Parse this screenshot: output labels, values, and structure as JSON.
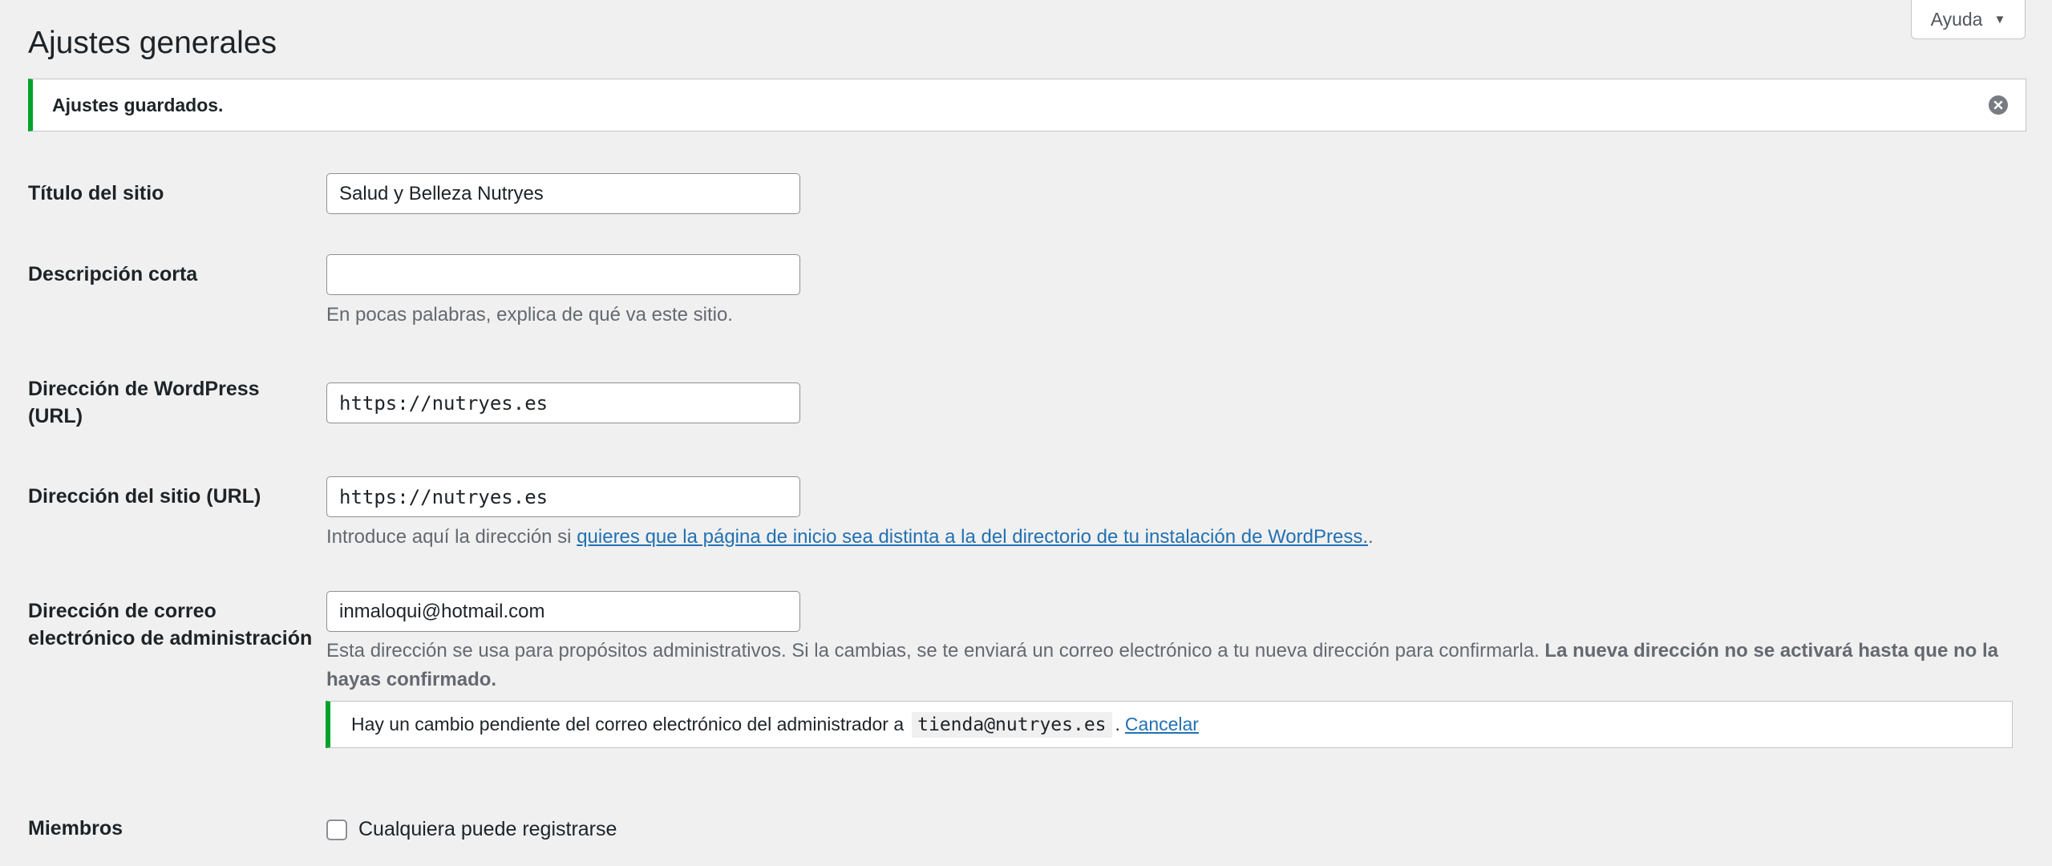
{
  "help_tab": {
    "label": "Ayuda"
  },
  "page": {
    "title": "Ajustes generales"
  },
  "notice": {
    "text": "Ajustes guardados."
  },
  "fields": {
    "site_title": {
      "label": "Título del sitio",
      "value": "Salud y Belleza Nutryes"
    },
    "tagline": {
      "label": "Descripción corta",
      "value": "",
      "description": "En pocas palabras, explica de qué va este sitio."
    },
    "wp_address": {
      "label_line1": "Dirección de WordPress",
      "label_line2": "(URL)",
      "value": "https://nutryes.es"
    },
    "site_address": {
      "label": "Dirección del sitio (URL)",
      "value": "https://nutryes.es",
      "description_prefix": "Introduce aquí la dirección si ",
      "description_link": "quieres que la página de inicio sea distinta a la del directorio de tu instalación de WordPress.",
      "description_suffix": "."
    },
    "admin_email": {
      "label_line1": "Dirección de correo",
      "label_line2": "electrónico de administración",
      "value": "inmaloqui@hotmail.com",
      "description": "Esta dirección se usa para propósitos administrativos. Si la cambias, se te enviará un correo electrónico a tu nueva dirección para confirmarla.",
      "description_bold": "La nueva dirección no se activará hasta que no la hayas confirmado.",
      "pending_text": "Hay un cambio pendiente del correo electrónico del administrador a",
      "pending_email": "tienda@nutryes.es",
      "pending_sep": ".",
      "cancel_label": "Cancelar"
    },
    "membership": {
      "label": "Miembros",
      "checkbox_label": "Cualquiera puede registrarse",
      "checked": false
    }
  },
  "colors": {
    "background": "#f0f0f1",
    "success_border": "#00a32a",
    "link": "#2271b1",
    "text": "#1d2327",
    "muted_text": "#646970"
  },
  "icons": {
    "dismiss": "dismiss-icon",
    "help_caret": "caret-down-icon"
  }
}
